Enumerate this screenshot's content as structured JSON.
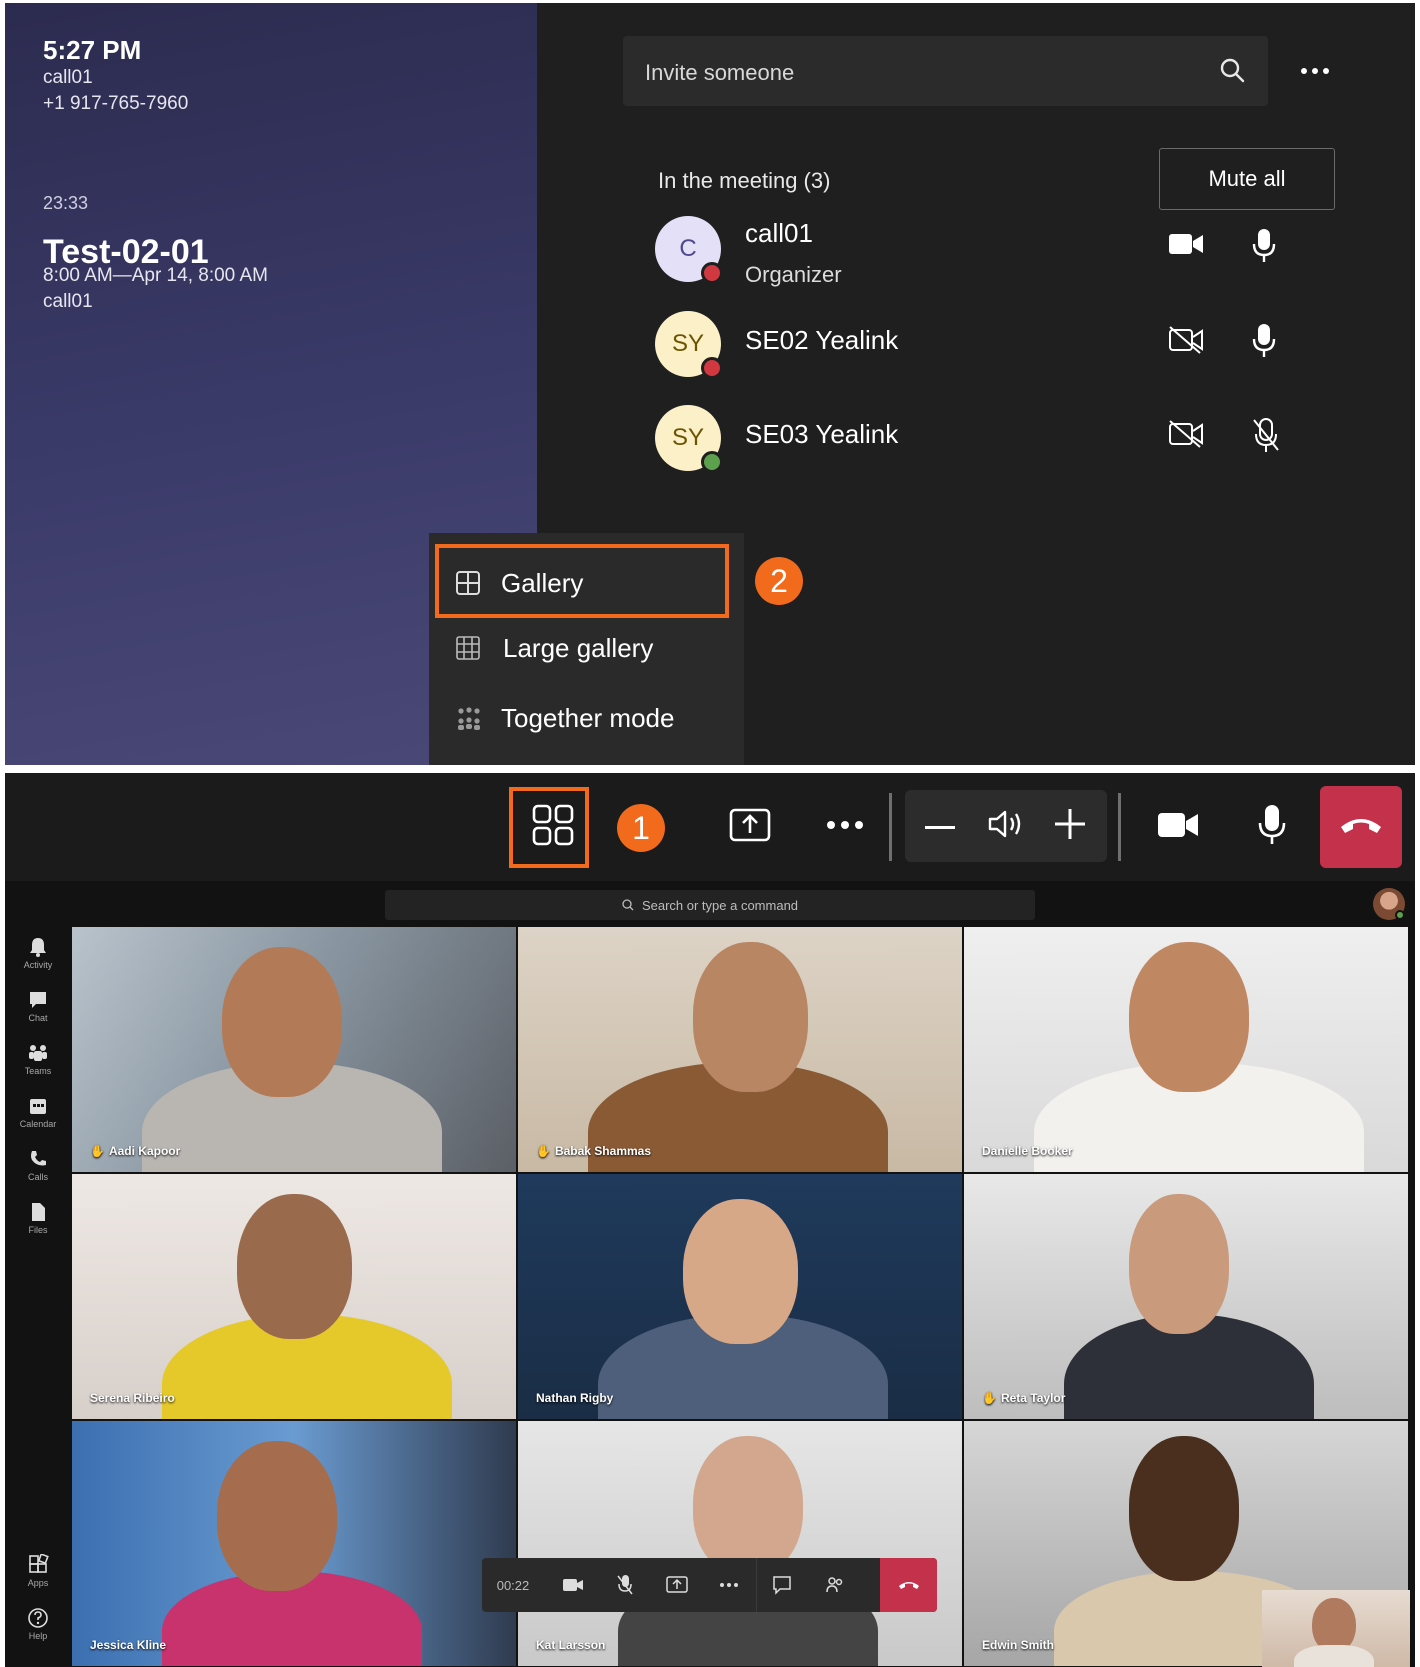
{
  "meeting_info": {
    "time": "5:27 PM",
    "caller_name": "call01",
    "caller_number": "+1 917-765-7960",
    "duration": "23:33",
    "title": "Test-02-01",
    "schedule": "8:00 AM—Apr 14, 8:00 AM",
    "organizer": "call01"
  },
  "roster": {
    "invite_placeholder": "Invite someone",
    "section_title": "In the meeting (3)",
    "mute_all_label": "Mute all",
    "participants": [
      {
        "initials": "C",
        "name": "call01",
        "role": "Organizer",
        "presence": "busy",
        "camera": "on",
        "mic": "on"
      },
      {
        "initials": "SY",
        "name": "SE02 Yealink",
        "role": "",
        "presence": "busy",
        "camera": "off",
        "mic": "on"
      },
      {
        "initials": "SY",
        "name": "SE03 Yealink",
        "role": "",
        "presence": "available",
        "camera": "off",
        "mic": "muted"
      }
    ]
  },
  "layout_menu": {
    "items": [
      {
        "label": "Gallery",
        "icon": "gallery-grid-icon",
        "selected": true
      },
      {
        "label": "Large gallery",
        "icon": "large-gallery-icon",
        "selected": false
      },
      {
        "label": "Together mode",
        "icon": "together-mode-icon",
        "selected": false
      }
    ]
  },
  "annotations": {
    "step1": "1",
    "step2": "2"
  },
  "control_bar": {
    "buttons": [
      "layout-icon",
      "share-screen-icon",
      "more-icon",
      "volume-down-icon",
      "speaker-icon",
      "volume-up-icon",
      "camera-icon",
      "mic-icon",
      "hangup-icon"
    ]
  },
  "teams": {
    "search_placeholder": "Search or type a command",
    "rail": [
      {
        "label": "Activity",
        "icon": "bell-icon"
      },
      {
        "label": "Chat",
        "icon": "chat-icon"
      },
      {
        "label": "Teams",
        "icon": "teams-icon"
      },
      {
        "label": "Calendar",
        "icon": "calendar-icon"
      },
      {
        "label": "Calls",
        "icon": "phone-icon"
      },
      {
        "label": "Files",
        "icon": "file-icon"
      },
      {
        "label": "Apps",
        "icon": "apps-icon"
      },
      {
        "label": "Help",
        "icon": "help-icon"
      }
    ],
    "tiles": [
      {
        "name": "Aadi Kapoor",
        "hand_raised": true
      },
      {
        "name": "Babak Shammas",
        "hand_raised": true
      },
      {
        "name": "Danielle Booker",
        "hand_raised": false
      },
      {
        "name": "Serena Ribeiro",
        "hand_raised": false
      },
      {
        "name": "Nathan Rigby",
        "hand_raised": false
      },
      {
        "name": "Reta Taylor",
        "hand_raised": true
      },
      {
        "name": "Jessica Kline",
        "hand_raised": false
      },
      {
        "name": "Kat Larsson",
        "hand_raised": false
      },
      {
        "name": "Edwin Smith",
        "hand_raised": false
      }
    ],
    "mini_bar": {
      "timer": "00:22"
    }
  },
  "colors": {
    "accent_orange": "#f26a1b",
    "hangup_red": "#c4314b",
    "busy_red": "#d1383f",
    "available_green": "#5da04d"
  }
}
